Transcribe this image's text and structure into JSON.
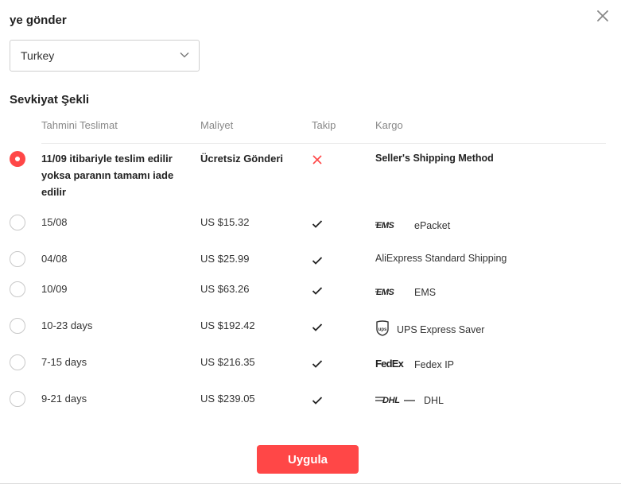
{
  "dialog": {
    "title": "ye gönder",
    "country": {
      "selected": "Turkey"
    },
    "section_title": "Sevkiyat Şekli",
    "headers": {
      "delivery": "Tahmini Teslimat",
      "cost": "Maliyet",
      "tracking": "Takip",
      "carrier": "Kargo"
    },
    "options": [
      {
        "delivery": "11/09 itibariyle teslim edilir yoksa paranın tamamı iade edilir",
        "cost": "Ücretsiz Gönderi",
        "tracking": false,
        "carrier": "Seller's Shipping Method",
        "logo": "none",
        "selected": true
      },
      {
        "delivery": "15/08",
        "cost": "US $15.32",
        "tracking": true,
        "carrier": "ePacket",
        "logo": "ems-logo",
        "selected": false
      },
      {
        "delivery": "04/08",
        "cost": "US $25.99",
        "tracking": true,
        "carrier": "AliExpress Standard Shipping",
        "logo": "none",
        "selected": false
      },
      {
        "delivery": "10/09",
        "cost": "US $63.26",
        "tracking": true,
        "carrier": "EMS",
        "logo": "ems-logo",
        "selected": false
      },
      {
        "delivery": "10-23 days",
        "cost": "US $192.42",
        "tracking": true,
        "carrier": "UPS Express Saver",
        "logo": "ups-logo",
        "selected": false
      },
      {
        "delivery": "7-15 days",
        "cost": "US $216.35",
        "tracking": true,
        "carrier": "Fedex IP",
        "logo": "fedex-logo",
        "selected": false
      },
      {
        "delivery": "9-21 days",
        "cost": "US $239.05",
        "tracking": true,
        "carrier": "DHL",
        "logo": "dhl-logo",
        "selected": false
      }
    ],
    "logo_text": {
      "ems": "EMS",
      "fedex": "FedEx",
      "dhl": "DHL"
    },
    "apply_label": "Uygula",
    "colors": {
      "accent": "#ff4747",
      "cross": "#ff4747",
      "check": "#222222"
    },
    "icons": {
      "close": "close-icon",
      "chevron": "chevron-down-icon",
      "check": "check-icon",
      "cross": "cross-icon"
    }
  }
}
